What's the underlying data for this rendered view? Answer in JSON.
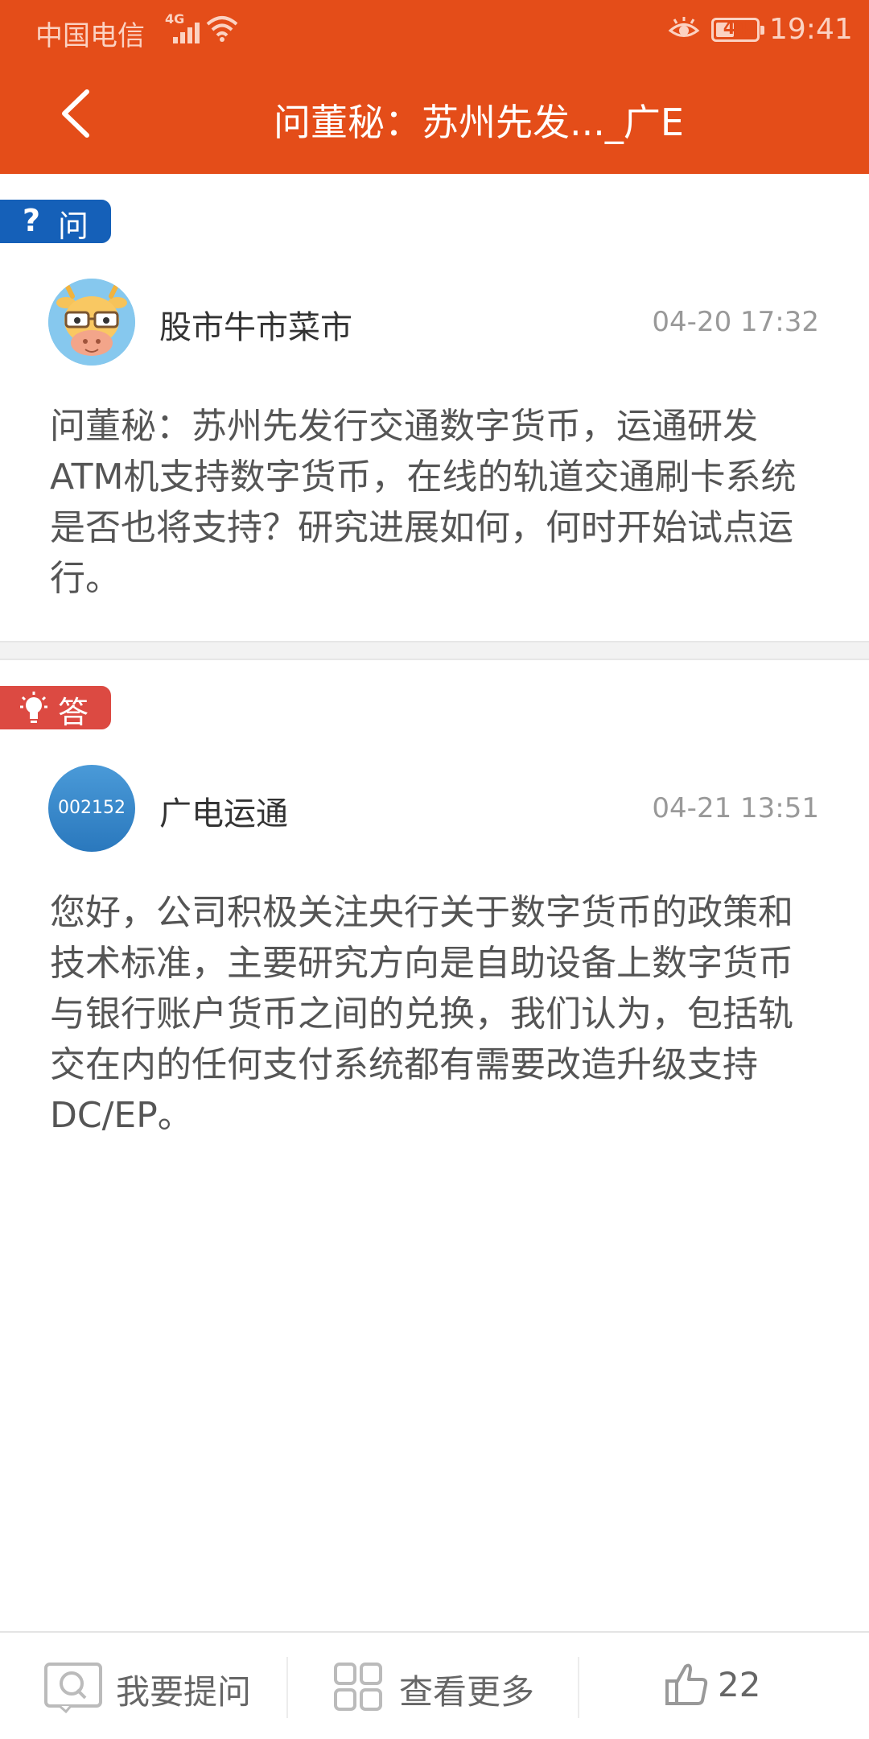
{
  "status_bar": {
    "carrier": "中国电信",
    "network": "4G",
    "battery": "44",
    "time": "19:41"
  },
  "header": {
    "title": "问董秘：苏州先发..._广E"
  },
  "question": {
    "tag_label": "问",
    "user": "股市牛市菜市",
    "time": "04-20 17:32",
    "text": "问董秘：苏州先发行交通数字货币，运通研发ATM机支持数字货币，在线的轨道交通刷卡系统是否也将支持？研究进展如何，何时开始试点运行。"
  },
  "answer": {
    "tag_label": "答",
    "avatar_text": "002152",
    "user": "广电运通",
    "time": "04-21 13:51",
    "text": "您好，公司积极关注央行关于数字货币的政策和技术标准，主要研究方向是自助设备上数字货币与银行账户货币之间的兑换，我们认为，包括轨交在内的任何支付系统都有需要改造升级支持DC/EP。"
  },
  "bottom_bar": {
    "ask_label": "我要提问",
    "more_label": "查看更多",
    "like_count": "22"
  },
  "colors": {
    "header_bg": "#e44d19",
    "question_tag": "#1560b8",
    "answer_tag": "#dc4a42"
  }
}
